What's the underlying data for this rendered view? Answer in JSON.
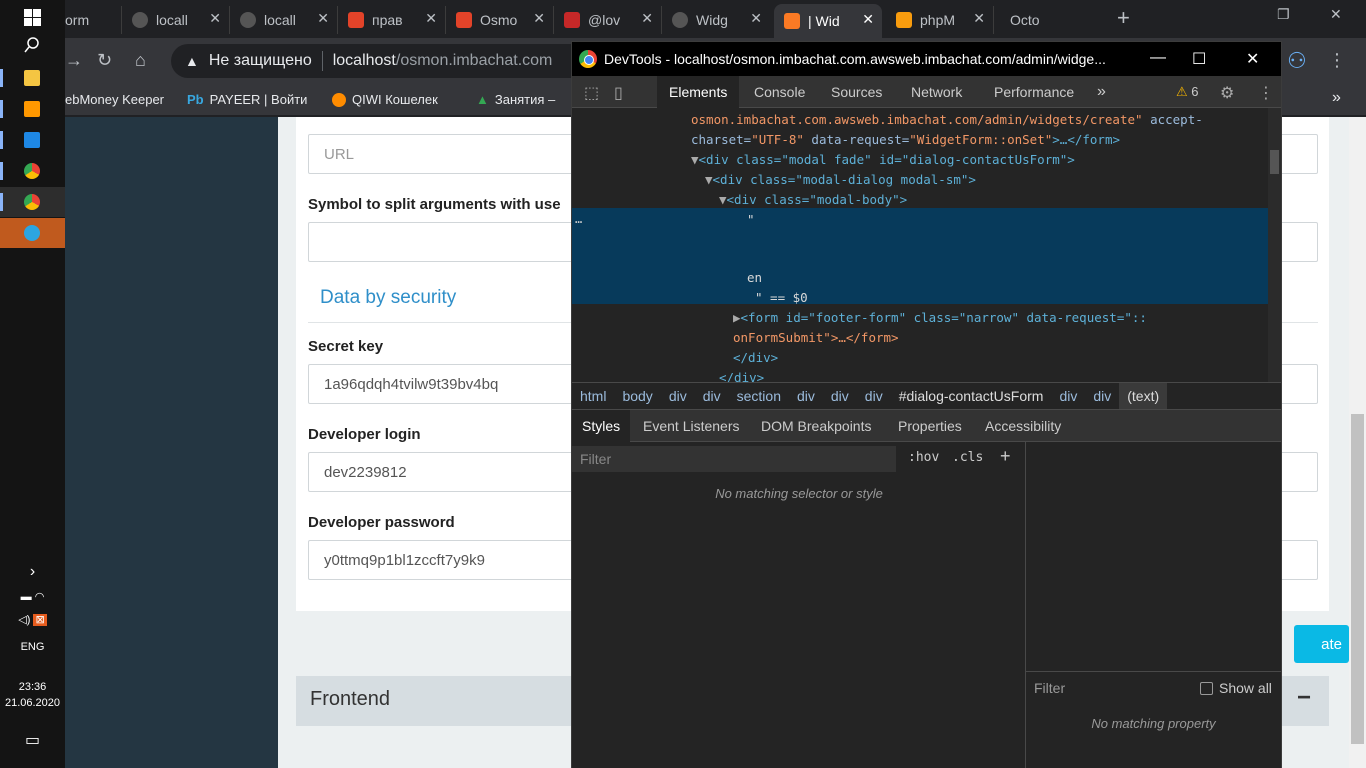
{
  "taskbar": {
    "language": "ENG",
    "time": "23:36",
    "date": "21.06.2020"
  },
  "tabs": [
    {
      "label": "orm"
    },
    {
      "label": "locall"
    },
    {
      "label": "locall"
    },
    {
      "label": "прав"
    },
    {
      "label": "Osmo"
    },
    {
      "label": "@lov"
    },
    {
      "label": "Widg"
    },
    {
      "label": "| Wid"
    },
    {
      "label": "phpM"
    },
    {
      "label": "Octo"
    }
  ],
  "address": {
    "security": "Не защищено",
    "host": "localhost",
    "path": "/osmon.imbachat.com"
  },
  "bookmarks": [
    {
      "label": "ebMoney Keeper"
    },
    {
      "label": "PAYEER | Войти"
    },
    {
      "label": "QIWI Кошелек"
    },
    {
      "label": "Занятия –"
    }
  ],
  "page": {
    "url_placeholder": "URL",
    "split_label": "Symbol to split arguments with use",
    "section_title": "Data by security",
    "secret_key_label": "Secret key",
    "secret_key_value": "1a96qdqh4tvilw9t39bv4bq",
    "dev_login_label": "Developer login",
    "dev_login_value": "dev2239812",
    "dev_password_label": "Developer password",
    "dev_password_value": "y0ttmq9p1bl1zccft7y9k9",
    "create_button": "ate",
    "frontend_title": "Frontend",
    "frontend_toggle": "−"
  },
  "devtools": {
    "title": "DevTools - localhost/osmon.imbachat.com.awsweb.imbachat.com/admin/widge...",
    "tabs": [
      "Elements",
      "Console",
      "Sources",
      "Network",
      "Performance"
    ],
    "more_tabs": "»",
    "warnings": "6",
    "code": {
      "l1": "osmon.imbachat.com.awsweb.imbachat.com/admin/widgets/create\"",
      "l1b": " accept-",
      "l2a": "charset=",
      "l2b": "\"UTF-8\"",
      "l2c": " data-request=",
      "l2d": "\"WidgetForm::onSet\"",
      "l2e": ">…</form>",
      "l3": "<div class=\"modal fade\" id=\"dialog-contactUsForm\">",
      "l4": "<div class=\"modal-dialog modal-sm\">",
      "l5": "<div class=\"modal-body\">",
      "text_quote": "\"",
      "text_en": "en",
      "text_end": "\" == $0",
      "l6": "<form id=\"footer-form\" class=\"narrow\" data-request=\"::",
      "l7": "onFormSubmit\">…</form>",
      "l8": "</div>",
      "l9": "</div>"
    },
    "breadcrumbs": [
      "html",
      "body",
      "div",
      "div",
      "section",
      "div",
      "div",
      "div",
      "#dialog-contactUsForm",
      "div",
      "div",
      "(text)"
    ],
    "subtabs": [
      "Styles",
      "Event Listeners",
      "DOM Breakpoints",
      "Properties",
      "Accessibility"
    ],
    "styles_filter": "Filter",
    "hov": ":hov",
    "cls": ".cls",
    "no_match": "No matching selector or style",
    "computed_filter": "Filter",
    "show_all": "Show all",
    "no_property": "No matching property"
  }
}
